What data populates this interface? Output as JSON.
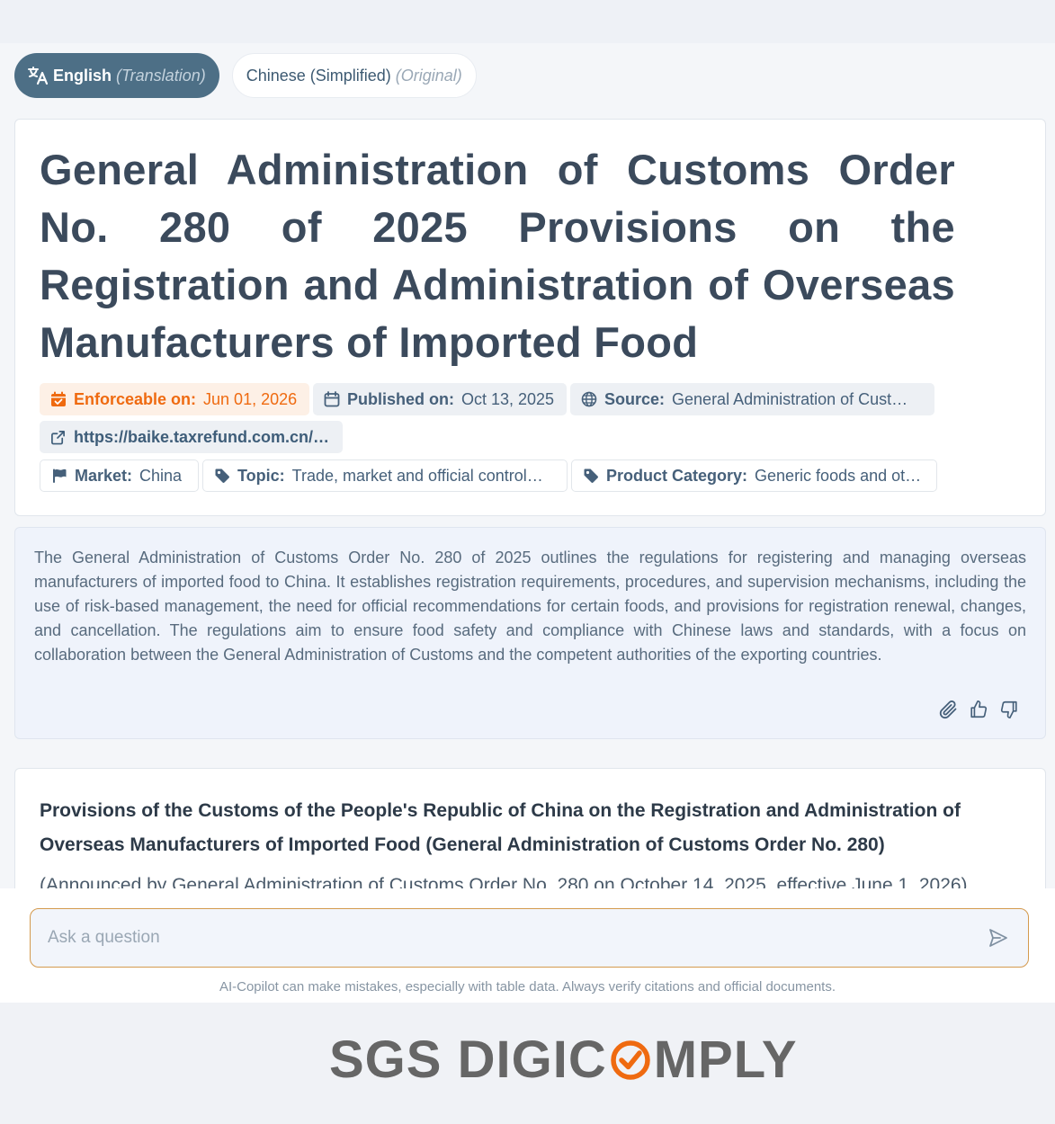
{
  "language_tabs": [
    {
      "label": "English",
      "sub": "(Translation)",
      "active": true
    },
    {
      "label": "Chinese (Simplified)",
      "sub": "(Original)",
      "active": false
    }
  ],
  "document": {
    "title": "General Administration of Customs Order No. 280 of 2025 Provisions on the Registration and Administration of Overseas Manufacturers of Imported Food",
    "enforceable_label": "Enforceable on:",
    "enforceable_value": "Jun 01, 2026",
    "published_label": "Published on:",
    "published_value": "Oct 13, 2025",
    "source_label": "Source:",
    "source_value": "General Administration of Cust…",
    "link": "https://baike.taxrefund.com.cn/ht…",
    "market_label": "Market:",
    "market_value": "China",
    "topic_label": "Topic:",
    "topic_value": "Trade, market and official control…",
    "category_label": "Product Category:",
    "category_value": "Generic foods and ot…"
  },
  "summary": {
    "text": "The General Administration of Customs Order No. 280 of 2025 outlines the regulations for registering and managing overseas manufacturers of imported food to China. It establishes registration requirements, procedures, and supervision mechanisms, including the use of risk-based management, the need for official recommendations for certain foods, and provisions for registration renewal, changes, and cancellation. The regulations aim to ensure food safety and compliance with Chinese laws and standards, with a focus on collaboration between the General Administration of Customs and the competent authorities of the exporting countries."
  },
  "content": {
    "heading": "Provisions of the Customs of the People's Republic of China on the Registration and Administration of Overseas Manufacturers of Imported Food (General Administration of Customs Order No. 280)",
    "first_line": "(Announced by General Administration of Customs Order No. 280 on October 14, 2025, effective June 1, 2026)"
  },
  "ask": {
    "placeholder": "Ask a question",
    "disclaimer": "AI-Copilot can make mistakes, especially with table data. Always verify citations and official documents."
  },
  "footer": {
    "logo_left": "SGS DIGIC",
    "logo_right": "MPLY"
  },
  "colors": {
    "accent_orange": "#ef6a10",
    "active_tab": "#4d6f86",
    "logo_gray": "#666666"
  }
}
